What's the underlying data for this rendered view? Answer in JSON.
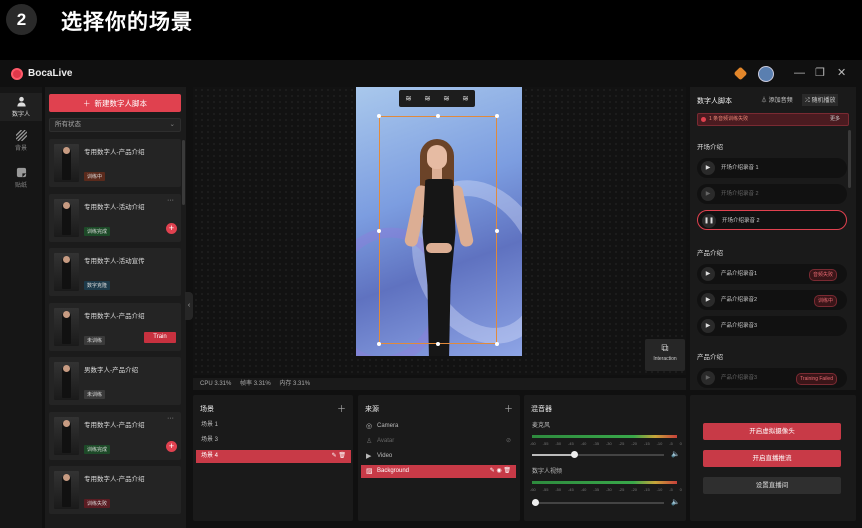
{
  "step": {
    "number": "2",
    "title": "选择你的场景"
  },
  "app": {
    "name": "BocaLive"
  },
  "titlebar": {
    "minimize": "—",
    "restore": "❐",
    "close": "✕"
  },
  "rail": [
    {
      "label": "数字人"
    },
    {
      "label": "背景"
    },
    {
      "label": "贴纸"
    }
  ],
  "list": {
    "add_label": "新建数字人脚本",
    "filter_value": "所有状态",
    "cards": [
      {
        "title": "专用数字人-产品介绍",
        "badge": "训练中",
        "badge_color": "#5a2a1c"
      },
      {
        "title": "专用数字人-活动介绍",
        "badge": "训练完成",
        "badge_color": "#1d4a28"
      },
      {
        "title": "专用数字人-活动宣传",
        "badge": "数字克隆",
        "badge_color": "#1d3a4a"
      },
      {
        "title": "专用数字人-产品介绍",
        "badge": "未训练",
        "badge_color": "#3a3a3a",
        "train": "Train"
      },
      {
        "title": "男数字人-产品介绍",
        "badge": "未训练",
        "badge_color": "#3a3a3a"
      },
      {
        "title": "专用数字人-产品介绍",
        "badge": "训练完成",
        "badge_color": "#1d4a28"
      },
      {
        "title": "专用数字人-产品介绍",
        "badge": "训练失败",
        "badge_color": "#5a1c22"
      }
    ]
  },
  "stage": {
    "interaction_label": "Interaction"
  },
  "stats": {
    "cpu": "CPU  3.31%",
    "fps": "帧率  3.31%",
    "mem": "内存  3.31%"
  },
  "script_panel": {
    "title": "数字人脚本",
    "add_audio": "添加音频",
    "random_play": "随机播放",
    "warning": "1 条音频训练失败",
    "warning_more": "更多",
    "sections": [
      {
        "title": "开场介绍",
        "tracks": [
          {
            "name": "开场介绍录音 1",
            "status": ""
          },
          {
            "name": "开场介绍录音 2",
            "status": ""
          },
          {
            "name": "开场介绍录音 2",
            "status": ""
          }
        ]
      },
      {
        "title": "产品介绍",
        "tracks": [
          {
            "name": "产品介绍录音1",
            "status": "音频失败"
          },
          {
            "name": "产品介绍录音2",
            "status": "训练中"
          },
          {
            "name": "产品介绍录音3",
            "status": ""
          }
        ]
      },
      {
        "title": "产品介绍",
        "tracks": [
          {
            "name": "产品介绍录音3",
            "status": "Training Failed"
          }
        ]
      }
    ]
  },
  "scenes": {
    "title": "场景",
    "items": [
      "场景 1",
      "场景 3",
      "场景 4"
    ]
  },
  "sources": {
    "title": "来源",
    "items": [
      "Camera",
      "Avatar",
      "Video",
      "Background"
    ]
  },
  "mixer": {
    "title": "混音器",
    "channels": [
      {
        "label": "麦克风",
        "level": 0.32
      },
      {
        "label": "数字人视频",
        "level": 0.02
      }
    ],
    "ticks": [
      "-60",
      "-55",
      "-50",
      "-45",
      "-40",
      "-35",
      "-30",
      "-25",
      "-20",
      "-15",
      "-10",
      "-5",
      "0"
    ]
  },
  "actions": {
    "virtual_cam": "开启虚拟摄像头",
    "live": "开启直播推流",
    "settings": "设置直播间"
  }
}
